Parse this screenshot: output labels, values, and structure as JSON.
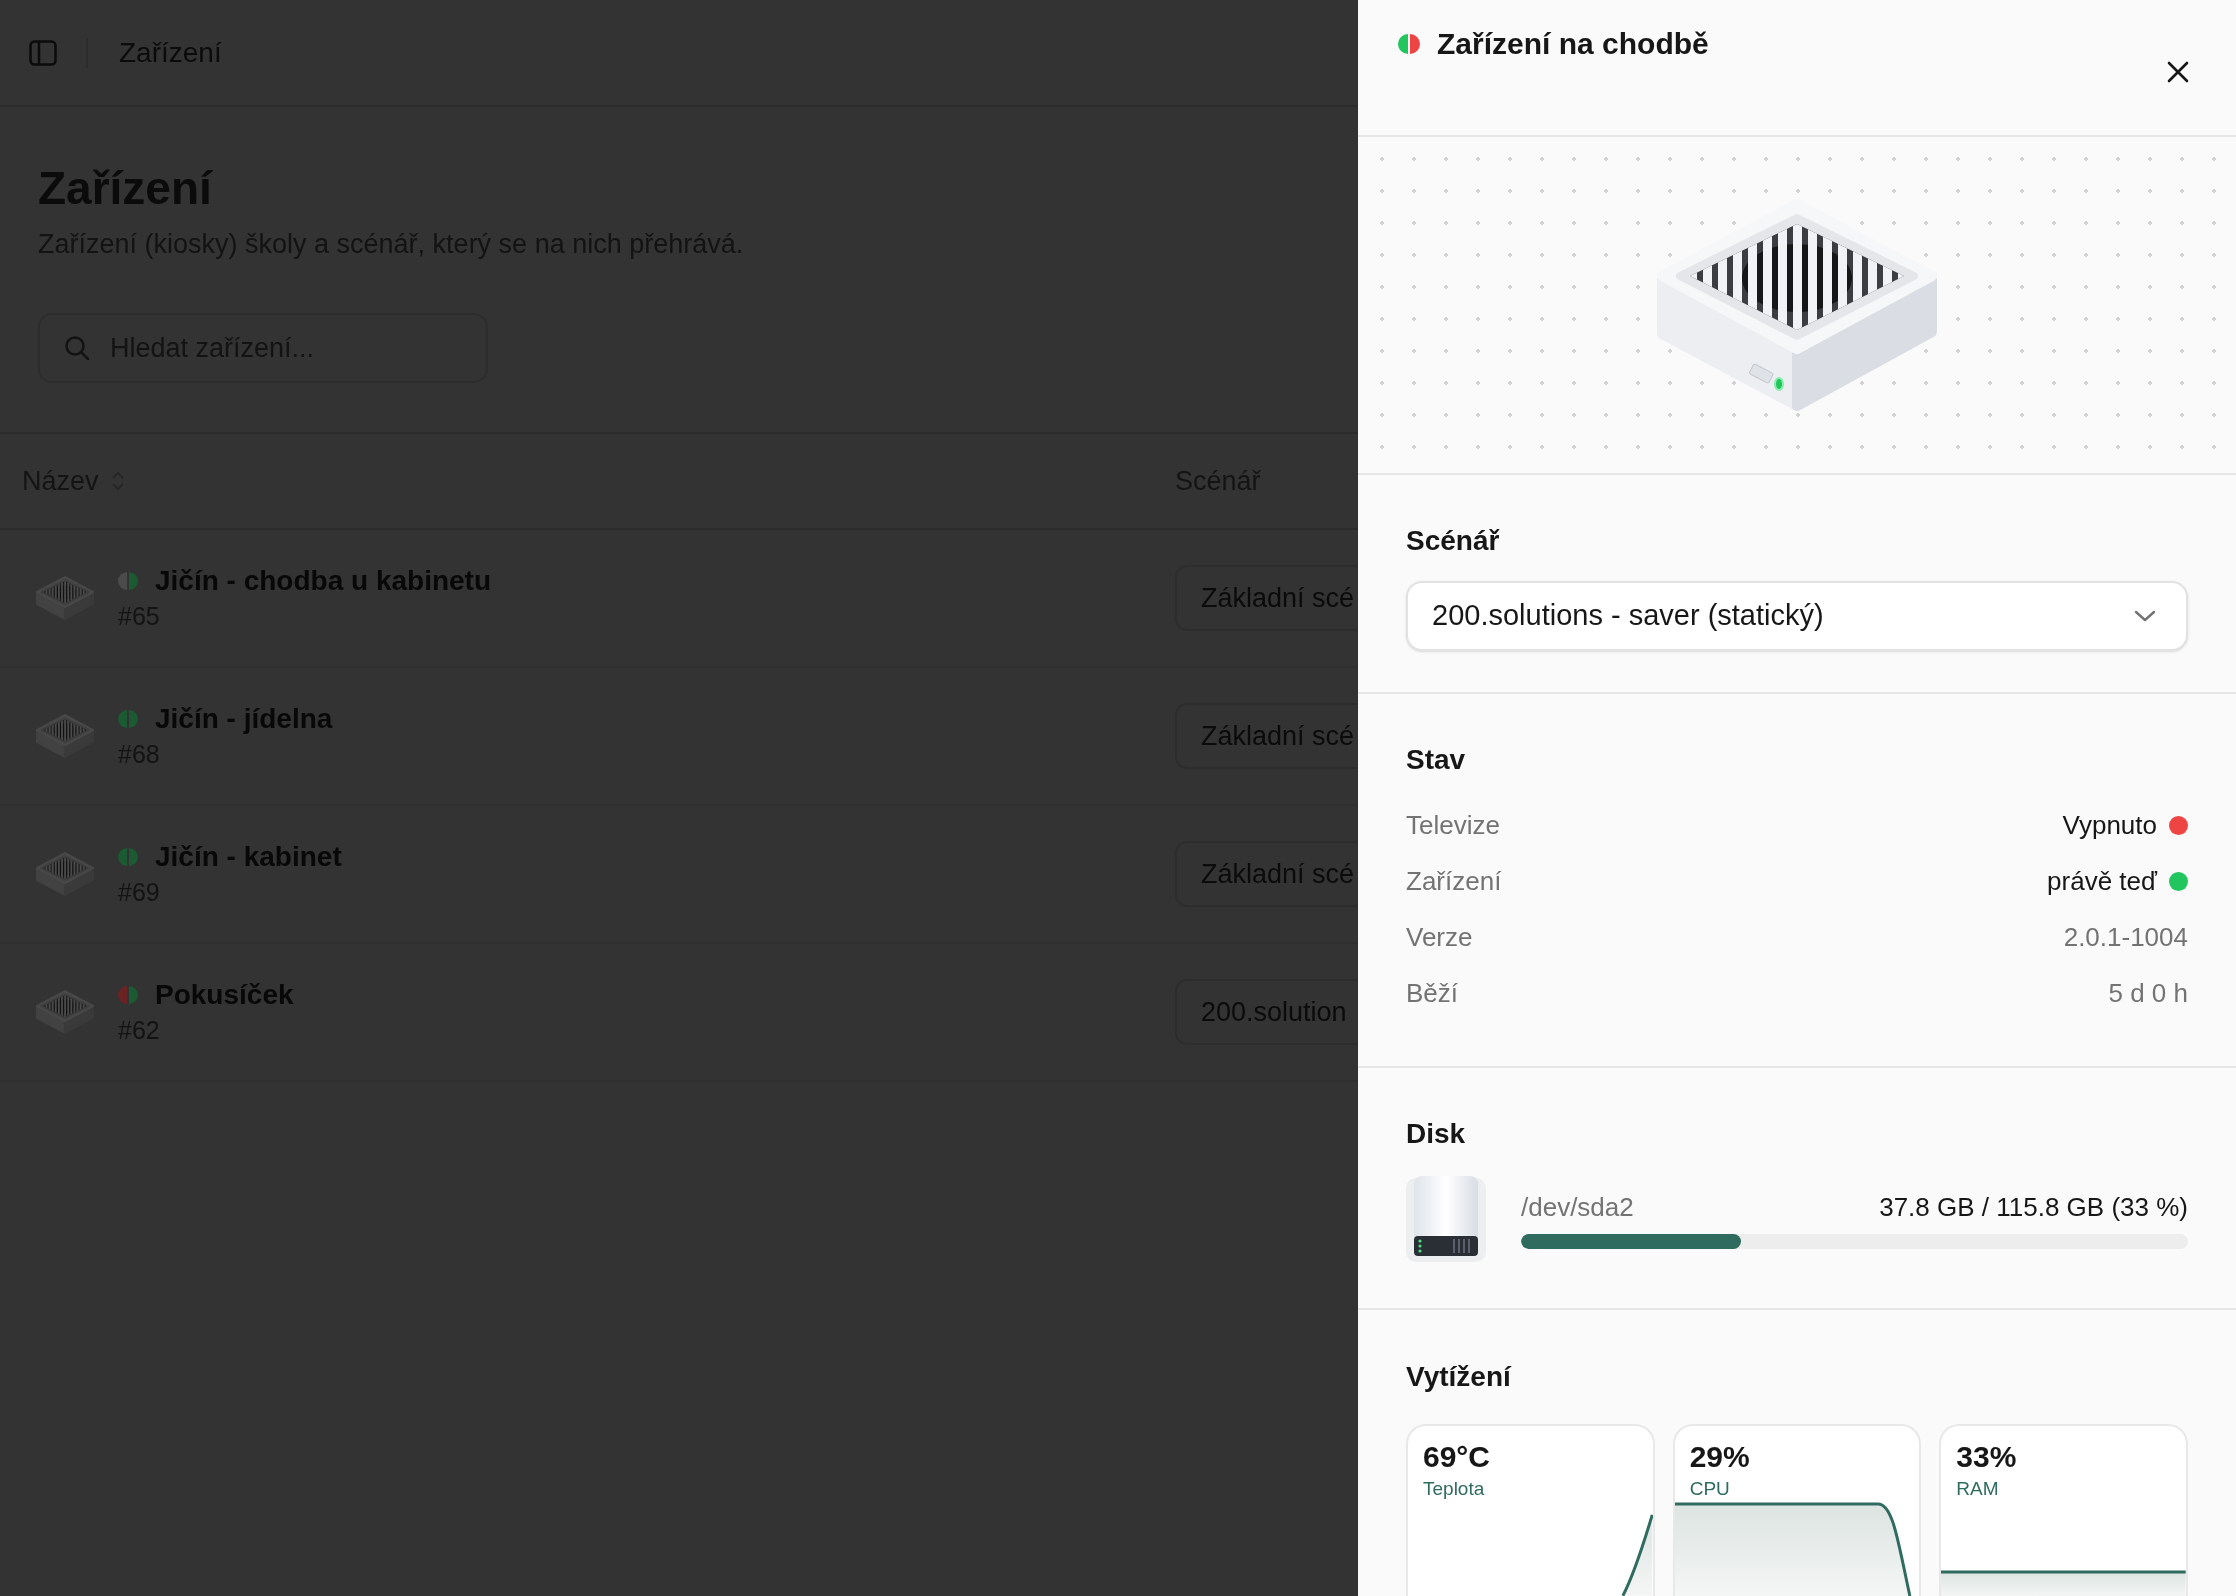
{
  "topbar": {
    "title": "Zařízení"
  },
  "page": {
    "title": "Zařízení",
    "subtitle": "Zařízení (kiosky) školy a scénář, který se na nich přehrává.",
    "search": {
      "placeholder": "Hledat zařízení..."
    }
  },
  "table": {
    "columns": [
      {
        "label": "Název",
        "sortable": true
      },
      {
        "label": "Scénář",
        "sortable": false
      }
    ],
    "rows": [
      {
        "name": "Jičín - chodba u kabinetu",
        "number": "#65",
        "status_dots": [
          {
            "color": "#4b4b4b"
          },
          {
            "color": "#1b5a33"
          }
        ],
        "scenario": "Základní scé"
      },
      {
        "name": "Jičín - jídelna",
        "number": "#68",
        "status_dots": [
          {
            "color": "#1b5a33"
          },
          {
            "color": "#1b5a33"
          }
        ],
        "scenario": "Základní scé"
      },
      {
        "name": "Jičín - kabinet",
        "number": "#69",
        "status_dots": [
          {
            "color": "#1b5a33"
          },
          {
            "color": "#1b5a33"
          }
        ],
        "scenario": "Základní scé"
      },
      {
        "name": "Pokusíček",
        "number": "#62",
        "status_dots": [
          {
            "color": "#6a2222"
          },
          {
            "color": "#1b5a33"
          }
        ],
        "scenario": "200.solution"
      }
    ]
  },
  "detail_panel": {
    "title": "Zařízení na chodbě",
    "status_dots": [
      {
        "color": "#22c55e"
      },
      {
        "color": "#ef4444"
      }
    ],
    "scenario": {
      "heading": "Scénář",
      "value": "200.solutions - saver (statický)"
    },
    "status": {
      "heading": "Stav",
      "rows": [
        {
          "kind": "indicator",
          "label": "Televize",
          "value": "Vypnuto",
          "color": "#ef4444"
        },
        {
          "kind": "indicator",
          "label": "Zařízení",
          "value": "právě teď",
          "color": "#22c55e"
        },
        {
          "kind": "text",
          "label": "Verze",
          "value": "2.0.1-1004"
        },
        {
          "kind": "text",
          "label": "Běží",
          "value": "5 d 0 h"
        }
      ]
    },
    "disk": {
      "heading": "Disk",
      "device": "/dev/sda2",
      "usage": "37.8 GB / 115.8 GB (33 %)",
      "level": 0.33
    },
    "load": {
      "heading": "Vytížení",
      "cards": [
        {
          "kind": "rising",
          "value": "69°C",
          "label": "Teplota"
        },
        {
          "kind": "falling",
          "value": "29%",
          "label": "CPU"
        },
        {
          "kind": "flat",
          "value": "33%",
          "label": "RAM"
        }
      ]
    }
  }
}
